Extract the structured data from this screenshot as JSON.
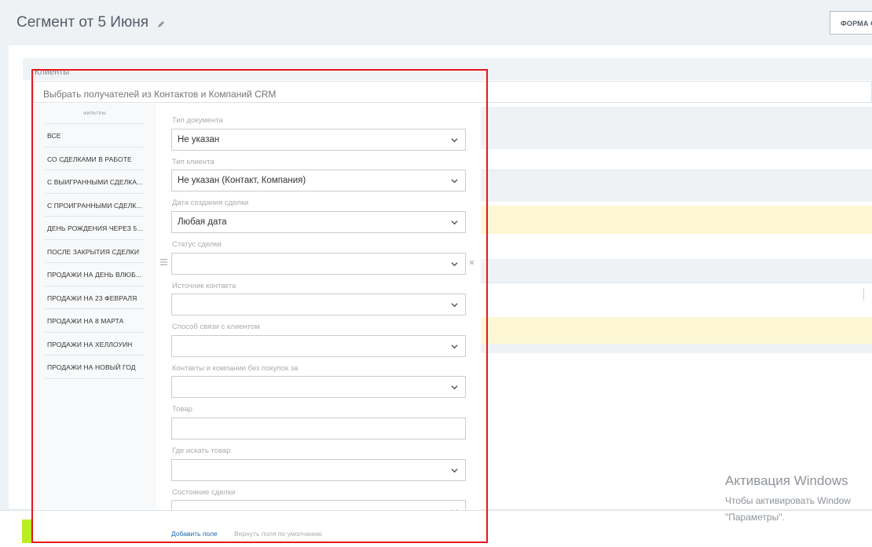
{
  "header": {
    "title": "Сегмент от 5 Июня",
    "form_button": "ФОРМА С"
  },
  "clients": {
    "label": "Клиенты",
    "placeholder": "Выбрать получателей из Контактов и Компаний CRM"
  },
  "filters": {
    "title": "ФИЛЬТРЫ",
    "items": [
      "ВСЕ",
      "СО СДЕЛКАМИ В РАБОТЕ",
      "С ВЫИГРАННЫМИ СДЕЛКА...",
      "С ПРОИГРАННЫМИ СДЕЛК...",
      "ДЕНЬ РОЖДЕНИЯ ЧЕРЕЗ 5 ...",
      "ПОСЛЕ ЗАКРЫТИЯ СДЕЛКИ",
      "ПРОДАЖИ НА ДЕНЬ ВЛЮБ...",
      "ПРОДАЖИ НА 23 ФЕВРАЛЯ",
      "ПРОДАЖИ НА 8 МАРТА",
      "ПРОДАЖИ НА ХЕЛЛОУИН",
      "ПРОДАЖИ НА НОВЫЙ ГОД"
    ]
  },
  "fields": [
    {
      "label": "Тип документа",
      "value": "Не указан"
    },
    {
      "label": "Тип клиента",
      "value": "Не указан (Контакт, Компания)"
    },
    {
      "label": "Дата создания сделки",
      "value": "Любая дата"
    },
    {
      "label": "Статус сделки",
      "value": ""
    },
    {
      "label": "Источник контакта",
      "value": ""
    },
    {
      "label": "Способ связи с клиентом",
      "value": ""
    },
    {
      "label": "Контакты и компании без покупок за",
      "value": ""
    },
    {
      "label": "Товар",
      "value": ""
    },
    {
      "label": "Где искать товар",
      "value": ""
    },
    {
      "label": "Состояние сделки",
      "value": ""
    }
  ],
  "actions": {
    "add_field": "Добавить поле",
    "reset_fields": "Вернуть поля по умолчанию"
  },
  "watermark": {
    "title": "Активация Windows",
    "line1": "Чтобы активировать Window",
    "line2": "\"Параметры\"."
  },
  "colors": {
    "highlight": "#e6171b",
    "link": "#2067b0",
    "accent_green": "#bbed21"
  }
}
